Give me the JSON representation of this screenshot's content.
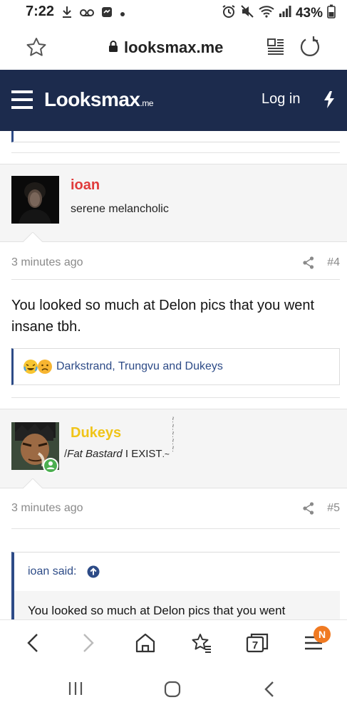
{
  "status_bar": {
    "time": "7:22",
    "battery": "43%"
  },
  "browser": {
    "url": "looksmax.me",
    "tab_count": "7",
    "menu_badge": "N"
  },
  "site_header": {
    "logo_main": "Looksmax",
    "logo_suffix": ".me",
    "login_label": "Log in"
  },
  "posts": [
    {
      "username": "ioan",
      "username_color": "#e03b3b",
      "user_title": "serene melancholic",
      "time_ago": "3 minutes ago",
      "post_number": "#4",
      "body": "You looked so much at Delon pics that you went insane tbh.",
      "reactions": "Darkstrand, Trungvu and Dukeys"
    },
    {
      "username": "Dukeys",
      "username_color": "#f0c419",
      "user_title": "I EXIST",
      "title_handwriting": "Fat Bastard",
      "time_ago": "3 minutes ago",
      "post_number": "#5",
      "quote_author": "ioan said:",
      "quote_text": "You looked so much at Delon pics that you went"
    }
  ],
  "colors": {
    "header_bg": "#1c2b4d",
    "link": "#2d4b87",
    "badge": "#f07a22"
  }
}
